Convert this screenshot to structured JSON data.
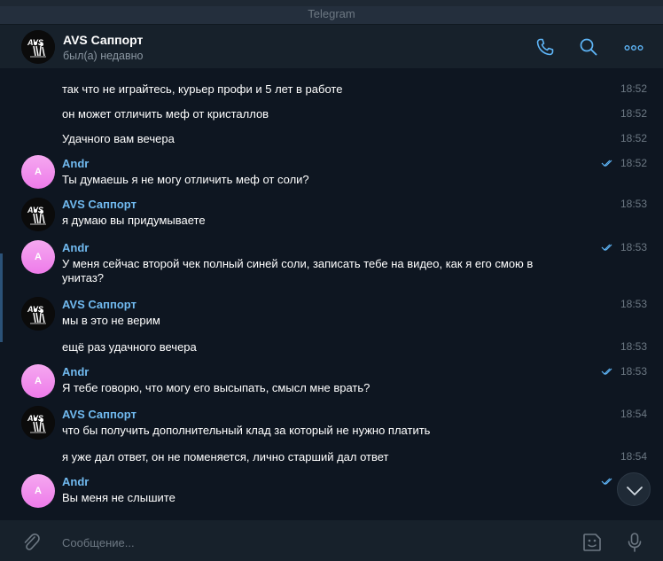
{
  "window": {
    "title": "Telegram"
  },
  "header": {
    "name": "AVS Саппорт",
    "status": "был(а) недавно",
    "avatar_label": "AVS",
    "icons": [
      "phone-icon",
      "search-icon",
      "more-icon"
    ]
  },
  "colors": {
    "accent": "#5eb5f7",
    "author": "#71baf0",
    "background": "#0e1621",
    "panel": "#17212b",
    "avatar_pink": "#ee7bea"
  },
  "messages": [
    {
      "id": 1,
      "text": "так что не играйтесь, курьер профи и 5 лет в работе",
      "time": "18:52"
    },
    {
      "id": 2,
      "text": "он может отличить меф от кристаллов",
      "time": "18:52"
    },
    {
      "id": 3,
      "text": "Удачного вам вечера",
      "time": "18:52"
    },
    {
      "id": 4,
      "author": "Andr",
      "avatar_letter": "A",
      "text": "Ты думаешь я не могу отличить меф от соли?",
      "time": "18:52",
      "read": true
    },
    {
      "id": 5,
      "author": "AVS Саппорт",
      "text": "я думаю вы придумываете",
      "time": "18:53"
    },
    {
      "id": 6,
      "author": "Andr",
      "avatar_letter": "A",
      "text": "У меня сейчас второй чек полный синей соли, записать тебе на видео, как я его смою в унитаз?",
      "time": "18:53",
      "read": true
    },
    {
      "id": 7,
      "author": "AVS Саппорт",
      "text": "мы в это не верим",
      "time": "18:53"
    },
    {
      "id": 8,
      "text": "ещё раз удачного вечера",
      "time": "18:53"
    },
    {
      "id": 9,
      "author": "Andr",
      "avatar_letter": "A",
      "text": "Я тебе говорю, что могу его высыпать, смысл мне врать?",
      "time": "18:53",
      "read": true
    },
    {
      "id": 10,
      "author": "AVS Саппорт",
      "text": "что бы получить дополнительный клад за который не нужно платить",
      "time": "18:54"
    },
    {
      "id": 11,
      "text": "я уже дал ответ, он не поменяется, лично старший дал ответ",
      "time": "18:54"
    },
    {
      "id": 12,
      "author": "Andr",
      "avatar_letter": "A",
      "text": "Вы меня не слышите",
      "read": true
    }
  ],
  "composer": {
    "placeholder": "Сообщение..."
  }
}
